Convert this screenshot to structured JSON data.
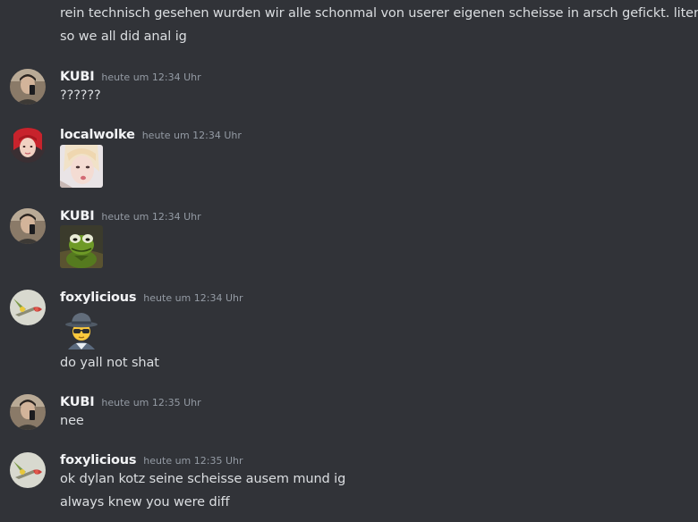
{
  "messages": [
    {
      "continuation_lines": [
        "rein technisch gesehen wurden wir alle schonmal von userer eigenen scheisse in arsch gefickt. literally",
        "so we all did anal ig"
      ]
    },
    {
      "username": "KUBI",
      "timestamp": "heute um 12:34 Uhr",
      "avatar": "kubi-avatar",
      "lines": [
        "??????"
      ]
    },
    {
      "username": "localwolke",
      "timestamp": "heute um 12:34 Uhr",
      "avatar": "localwolke-avatar",
      "attachment": "photo-of-person-image"
    },
    {
      "username": "KUBI",
      "timestamp": "heute um 12:34 Uhr",
      "avatar": "kubi-avatar",
      "attachment": "kermit-frog-image"
    },
    {
      "username": "foxylicious",
      "timestamp": "heute um 12:34 Uhr",
      "avatar": "foxylicious-avatar",
      "attachment": "spy-emoji",
      "lines": [
        "do yall not shat"
      ]
    },
    {
      "username": "KUBI",
      "timestamp": "heute um 12:35 Uhr",
      "avatar": "kubi-avatar",
      "lines": [
        "nee"
      ]
    },
    {
      "username": "foxylicious",
      "timestamp": "heute um 12:35 Uhr",
      "avatar": "foxylicious-avatar",
      "lines": [
        "ok dylan kotz seine scheisse ausem mund ig",
        "always knew you were diff"
      ]
    }
  ],
  "colors": {
    "background": "#313338",
    "username": "#f2f3f5",
    "message_text": "#dbdee1",
    "timestamp": "#949ba4"
  }
}
